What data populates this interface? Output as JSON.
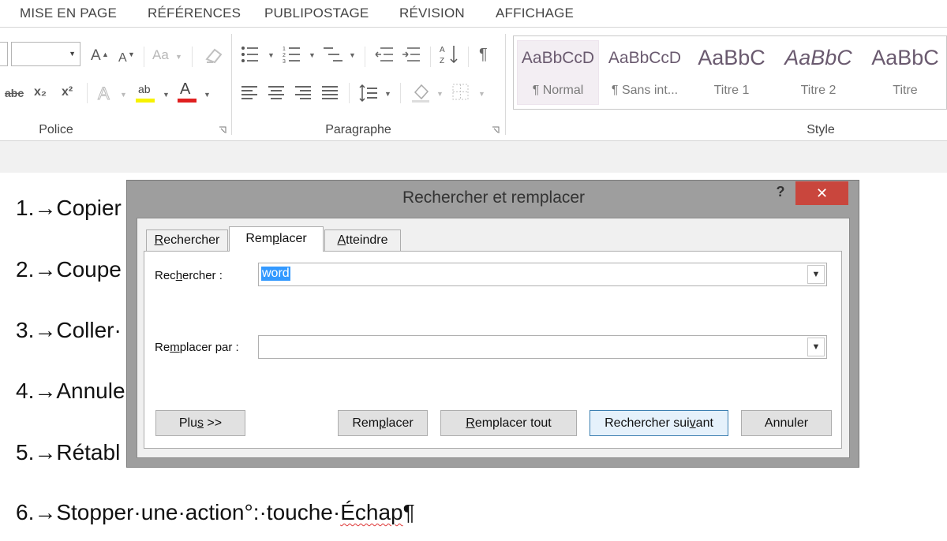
{
  "ribbon": {
    "tabs": [
      "MISE EN PAGE",
      "RÉFÉRENCES",
      "PUBLIPOSTAGE",
      "RÉVISION",
      "AFFICHAGE"
    ],
    "groups": {
      "police": "Police",
      "paragraphe": "Paragraphe",
      "style": "Style"
    },
    "font_icons": {
      "grow": "A",
      "shrink": "A",
      "case": "Aa",
      "strike": "abc",
      "subscript": "x₂",
      "superscript": "x²",
      "highlight": "ab",
      "font_color": "A"
    },
    "styles": [
      {
        "sample": "AaBbCcD",
        "name": "¶ Normal"
      },
      {
        "sample": "AaBbCcD",
        "name": "¶ Sans int..."
      },
      {
        "sample": "AaBbC",
        "name": "Titre 1"
      },
      {
        "sample": "AaBbC",
        "name": "Titre 2"
      },
      {
        "sample": "AaBbC",
        "name": "Titre"
      }
    ]
  },
  "document": {
    "lines": [
      "1.→Copier",
      "2.→Coupe",
      "3.→Coller·",
      "4.→Annule",
      "5.→Rétabl",
      "6.→Stopper·une·action°:·touche·"
    ],
    "last_word": "Échap",
    "pilcrow": "¶"
  },
  "dialog": {
    "title": "Rechercher et remplacer",
    "help": "?",
    "close": "✕",
    "tabs": [
      {
        "pre": "",
        "key": "R",
        "post": "echercher"
      },
      {
        "pre": "Rem",
        "key": "p",
        "post": "lacer"
      },
      {
        "pre": "",
        "key": "A",
        "post": "tteindre"
      }
    ],
    "find_label": {
      "pre": "Rec",
      "key": "h",
      "post": "ercher :"
    },
    "find_value": "word",
    "replace_label": {
      "pre": "Re",
      "key": "m",
      "post": "placer par :"
    },
    "replace_value": "",
    "buttons": {
      "plus": {
        "pre": "Plu",
        "key": "s",
        "post": " >>"
      },
      "replace": {
        "pre": "Rem",
        "key": "p",
        "post": "lacer"
      },
      "replace_all": {
        "pre": "",
        "key": "R",
        "post": "emplacer tout"
      },
      "find_next": {
        "pre": "Rechercher sui",
        "key": "v",
        "post": "ant"
      },
      "cancel": {
        "pre": "Annuler",
        "key": "",
        "post": ""
      }
    }
  }
}
